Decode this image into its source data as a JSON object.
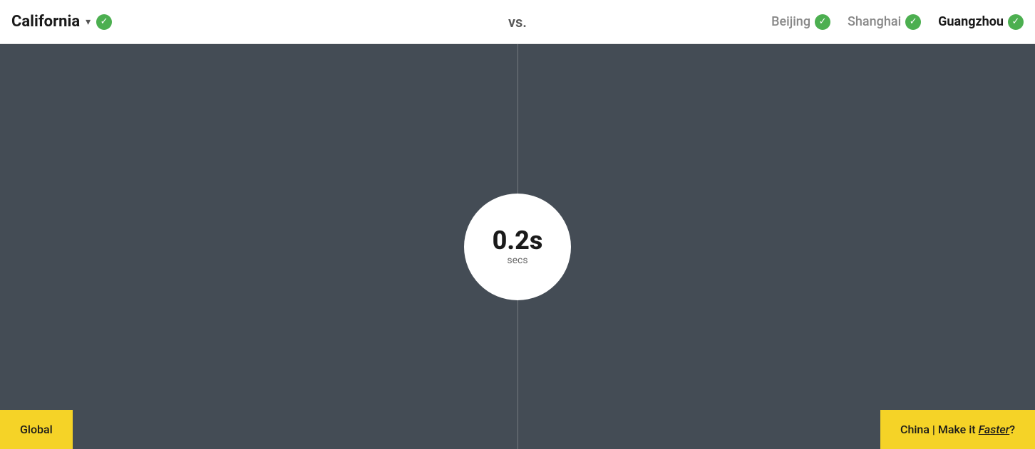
{
  "header": {
    "location_left": "California",
    "chevron": "▾",
    "vs_label": "vs.",
    "locations_right": [
      {
        "name": "Beijing",
        "active": false
      },
      {
        "name": "Shanghai",
        "active": false
      },
      {
        "name": "Guangzhou",
        "active": true
      }
    ]
  },
  "main": {
    "time_value": "0.2s",
    "time_unit": "secs"
  },
  "badges": {
    "global_label": "Global",
    "china_prefix": "China | Make it ",
    "china_faster": "Faster",
    "china_suffix": "?"
  }
}
